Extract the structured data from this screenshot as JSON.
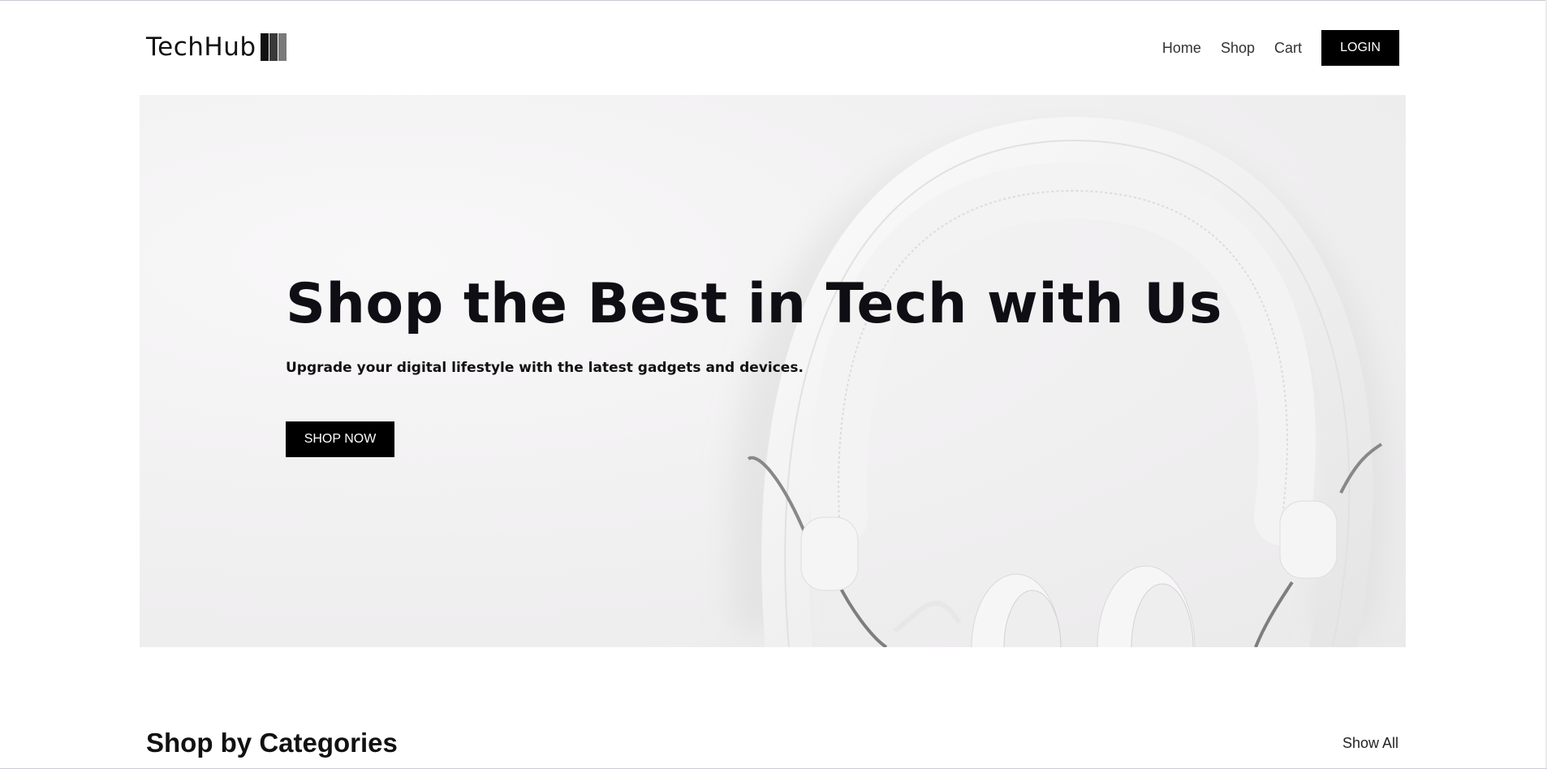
{
  "brand": {
    "name": "TechHub"
  },
  "nav": {
    "items": [
      "Home",
      "Shop",
      "Cart"
    ],
    "login_label": "LOGIN"
  },
  "hero": {
    "title": "Shop the Best in Tech with Us",
    "subtitle": "Upgrade your digital lifestyle with the latest gadgets and devices.",
    "cta_label": "SHOP NOW",
    "image": "white-headphones"
  },
  "categories": {
    "title": "Shop by Categories",
    "show_all_label": "Show All"
  },
  "colors": {
    "primary_button": "#000000",
    "button_text": "#ffffff",
    "hero_background": "#f2f1f2"
  }
}
